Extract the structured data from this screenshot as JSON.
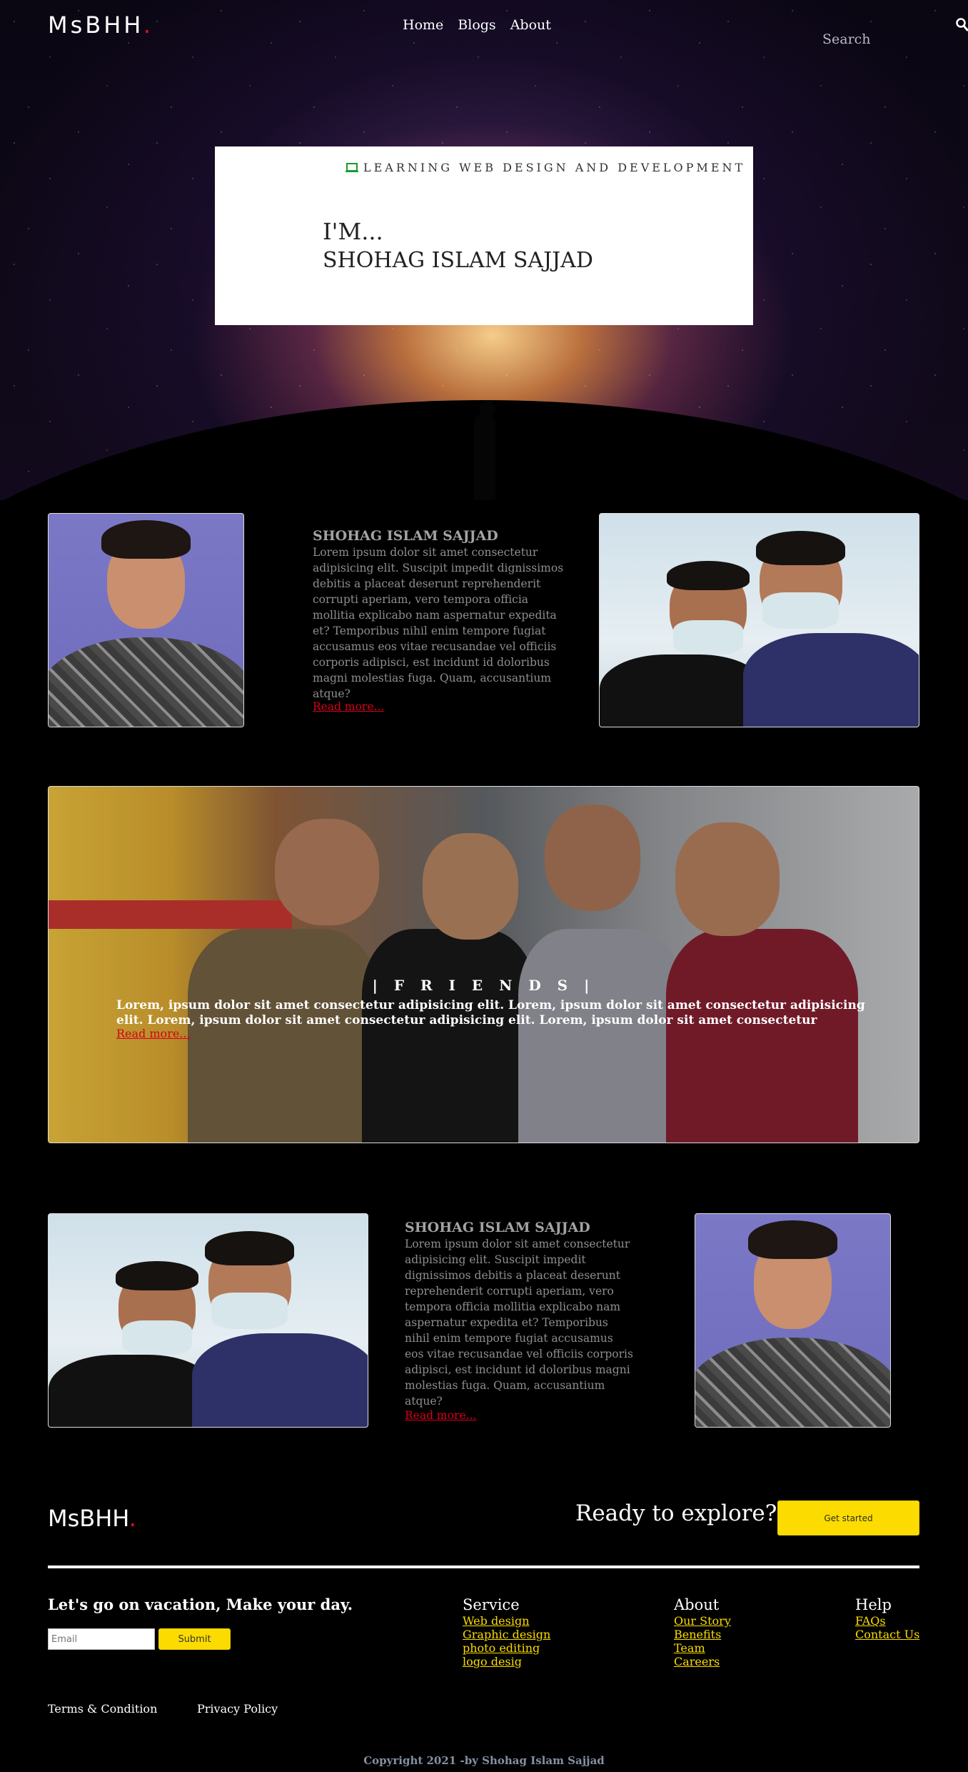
{
  "nav": {
    "logo": "MsBHH",
    "logo_dot": ".",
    "links": [
      "Home",
      "Blogs",
      "About"
    ],
    "search_placeholder": "Search"
  },
  "hero": {
    "tagline": "LEARNING WEB DESIGN AND DEVELOPMENT",
    "intro": "I'M...",
    "name": "SHOHAG ISLAM SAJJAD"
  },
  "about1": {
    "title": "SHOHAG ISLAM SAJJAD",
    "text": "Lorem ipsum dolor sit amet consectetur adipisicing elit. Suscipit impedit dignissimos debitis a placeat deserunt reprehenderit corrupti aperiam, vero tempora officia mollitia explicabo nam aspernatur expedita et? Temporibus nihil enim tempore fugiat accusamus eos vitae recusandae vel officiis corporis adipisci, est incidunt id doloribus magni molestias fuga. Quam, accusantium atque?",
    "read_more": "Read more..."
  },
  "friends": {
    "title": "| F R I E N D S |",
    "text": "Lorem, ipsum dolor sit amet consectetur adipisicing elit. Lorem, ipsum dolor sit amet consectetur adipisicing elit. Lorem, ipsum dolor sit amet consectetur adipisicing elit. Lorem, ipsum dolor sit amet consectetur",
    "read_more": "Read more..."
  },
  "about2": {
    "title": "SHOHAG ISLAM SAJJAD",
    "text": "Lorem ipsum dolor sit amet consectetur adipisicing elit. Suscipit impedit dignissimos debitis a placeat deserunt reprehenderit corrupti aperiam, vero tempora officia mollitia explicabo nam aspernatur expedita et? Temporibus nihil enim tempore fugiat accusamus eos vitae recusandae vel officiis corporis adipisci, est incidunt id doloribus magni molestias fuga. Quam, accusantium atque?",
    "read_more": "Read more..."
  },
  "footer": {
    "logo": "MsBHH",
    "logo_dot": ".",
    "explore": "Ready to explore?",
    "get_started": "Get started",
    "vacation": "Let's go on vacation, Make your day.",
    "email_placeholder": "Email",
    "submit": "Submit",
    "columns": [
      {
        "title": "Service",
        "links": [
          "Web design",
          "Graphic design",
          "photo editing",
          "logo desig"
        ]
      },
      {
        "title": "About",
        "links": [
          "Our Story",
          "Benefits",
          "Team",
          "Careers"
        ]
      },
      {
        "title": "Help",
        "links": [
          "FAQs",
          "Contact Us"
        ]
      }
    ],
    "terms": "Terms & Condition",
    "privacy": "Privacy Policy",
    "copyright": "Copyright 2021 -by Shohag Islam Sajjad"
  },
  "colors": {
    "accent_red": "#e0102a",
    "link_yellow": "#fcdc00",
    "background": "#000000"
  },
  "icons": [
    "search-icon",
    "laptop-icon"
  ]
}
